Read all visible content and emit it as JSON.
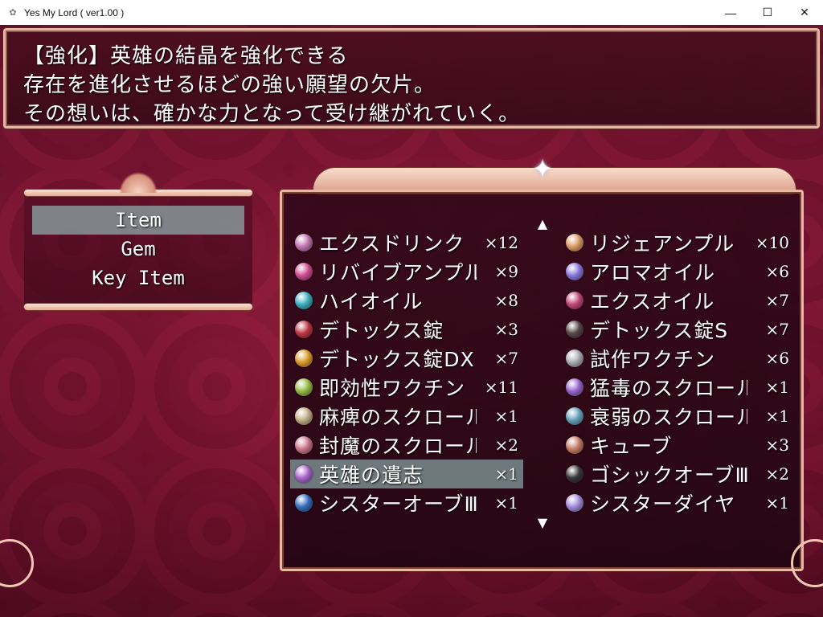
{
  "window": {
    "title": "Yes My Lord ( ver1.00 )",
    "minimize": "—",
    "maximize": "☐",
    "close": "✕"
  },
  "help": {
    "lines": [
      "【強化】英雄の結晶を強化できる",
      "存在を進化させるほどの強い願望の欠片。",
      "その想いは、確かな力となって受け継がれていく。"
    ]
  },
  "categories": [
    {
      "label": "Item",
      "selected": true
    },
    {
      "label": "Gem",
      "selected": false
    },
    {
      "label": "Key Item",
      "selected": false
    }
  ],
  "scroll": {
    "up": "▲",
    "down": "▼"
  },
  "star": "✦",
  "items": [
    {
      "name": "エクスドリンク",
      "count": "×12",
      "icon_color": "#c77bb4",
      "icon": "potion-icon"
    },
    {
      "name": "リジェアンプル",
      "count": "×10",
      "icon_color": "#e0a06a",
      "icon": "potion-icon"
    },
    {
      "name": "リバイブアンプル",
      "count": "×9",
      "icon_color": "#d44f96",
      "icon": "potion-icon"
    },
    {
      "name": "アロマオイル",
      "count": "×6",
      "icon_color": "#8b7ce0",
      "icon": "vial-icon"
    },
    {
      "name": "ハイオイル",
      "count": "×8",
      "icon_color": "#3fb4c4",
      "icon": "vial-icon"
    },
    {
      "name": "エクスオイル",
      "count": "×7",
      "icon_color": "#c74a7c",
      "icon": "vial-icon"
    },
    {
      "name": "デトックス錠",
      "count": "×3",
      "icon_color": "#c23a4a",
      "icon": "pill-icon"
    },
    {
      "name": "デトックス錠S",
      "count": "×7",
      "icon_color": "#5a4a4a",
      "icon": "pill-icon"
    },
    {
      "name": "デトックス錠DX",
      "count": "×7",
      "icon_color": "#e0a030",
      "icon": "pill-icon"
    },
    {
      "name": "試作ワクチン",
      "count": "×6",
      "icon_color": "#b0b0b8",
      "icon": "bottle-icon"
    },
    {
      "name": "即効性ワクチン",
      "count": "×11",
      "icon_color": "#9bbf4a",
      "icon": "bottle-icon"
    },
    {
      "name": "猛毒のスクロールⅡ",
      "count": "×1",
      "icon_color": "#9a6ad0",
      "icon": "scroll-icon"
    },
    {
      "name": "麻痺のスクロールⅡ",
      "count": "×1",
      "icon_color": "#c9b48a",
      "icon": "scroll-icon"
    },
    {
      "name": "衰弱のスクロールⅡ",
      "count": "×1",
      "icon_color": "#6aa6c0",
      "icon": "scroll-icon"
    },
    {
      "name": "封魔のスクロールⅡ",
      "count": "×2",
      "icon_color": "#d07a90",
      "icon": "scroll-icon"
    },
    {
      "name": "キューブ",
      "count": "×3",
      "icon_color": "#c9806a",
      "icon": "cube-icon"
    },
    {
      "name": "英雄の遺志",
      "count": "×1",
      "icon_color": "#b06ad0",
      "icon": "orb-cluster-icon",
      "selected": true
    },
    {
      "name": "ゴシックオーブⅢ",
      "count": "×2",
      "icon_color": "#3a3a3a",
      "icon": "orb-icon"
    },
    {
      "name": "シスターオーブⅢ",
      "count": "×1",
      "icon_color": "#3a70c0",
      "icon": "orb-icon"
    },
    {
      "name": "シスターダイヤ",
      "count": "×1",
      "icon_color": "#a890e0",
      "icon": "diamond-icon"
    }
  ]
}
